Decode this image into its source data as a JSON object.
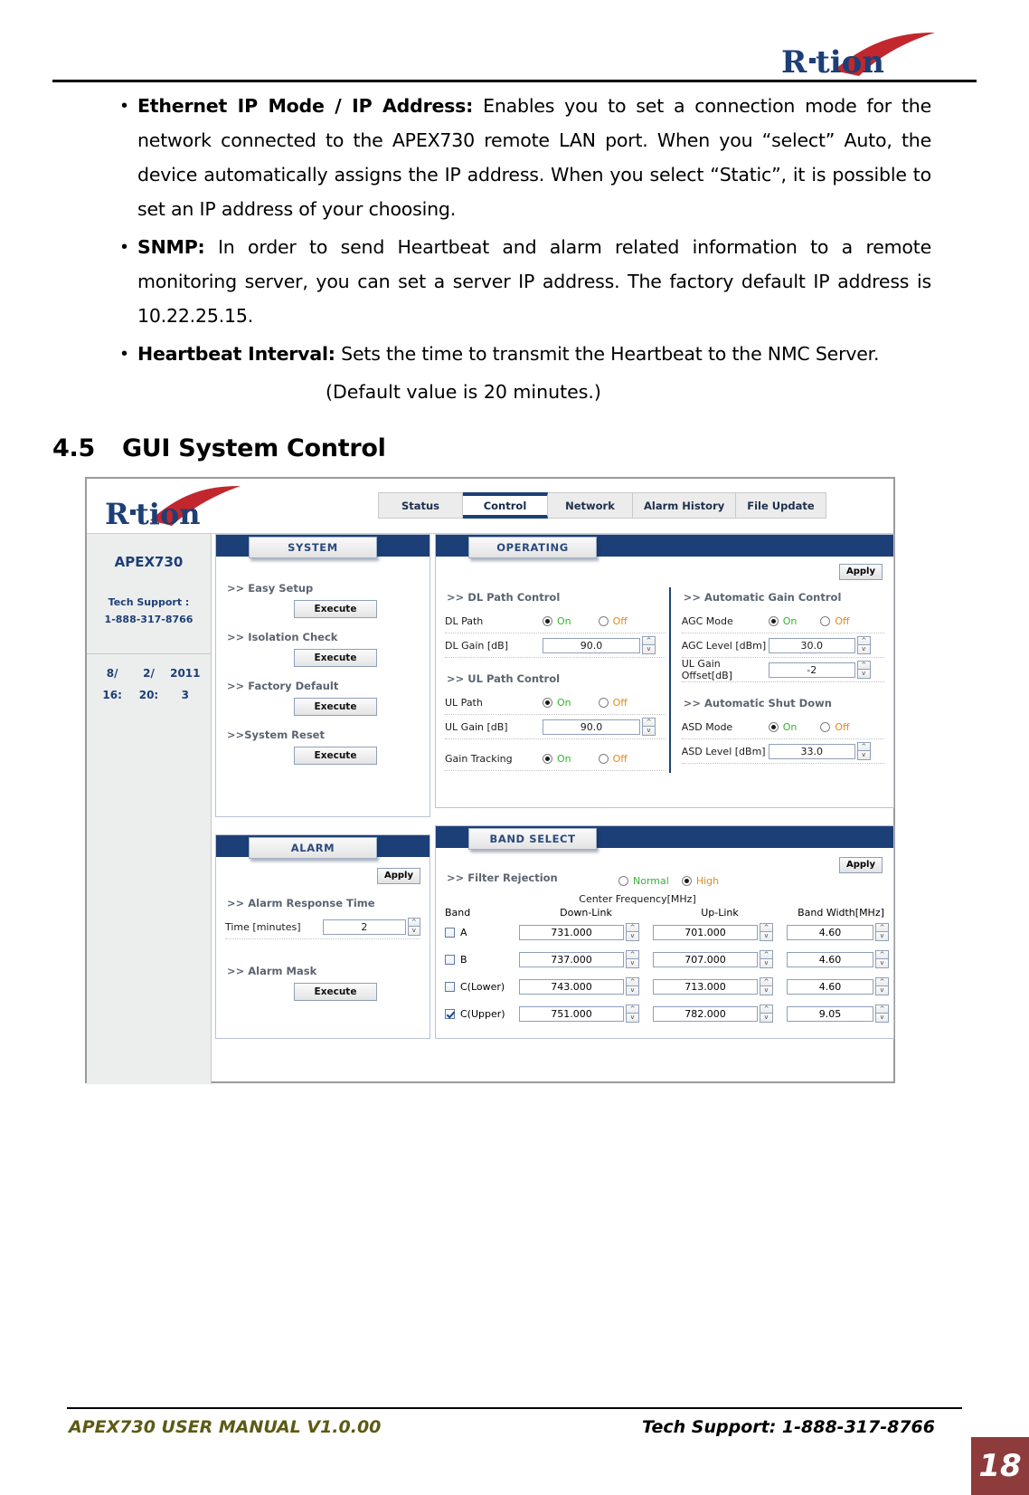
{
  "header": {
    "brand": "R-tion"
  },
  "content": {
    "bullets": [
      {
        "marker": "•",
        "term": "Ethernet IP Mode / IP Address:",
        "text": " Enables you to set a connection mode for the network connected to the APEX730 remote LAN port. When you “select” Auto, the device automatically assigns the IP address. When you select “Static”, it is possible to set an IP address of your choosing."
      },
      {
        "marker": "•",
        "term": "SNMP:",
        "text": " In order to send Heartbeat and alarm related information to a remote monitoring server, you can set a server IP address. The factory default IP address is 10.22.25.15."
      },
      {
        "marker": "•",
        "term": "Heartbeat Interval:",
        "text": " Sets the time to transmit the Heartbeat to the NMC Server."
      }
    ],
    "default_note": "(Default value is 20 minutes.)",
    "section": {
      "number": "4.5",
      "title": "GUI System Control"
    }
  },
  "gui": {
    "tabs": [
      {
        "label": "Status",
        "active": false
      },
      {
        "label": "Control",
        "active": true
      },
      {
        "label": "Network",
        "active": false
      },
      {
        "label": "Alarm History",
        "active": false
      },
      {
        "label": "File Update",
        "active": false
      }
    ],
    "sidebar": {
      "model": "APEX730",
      "support_label": "Tech Support :",
      "support_phone": "1-888-317-8766",
      "clock": [
        "8/",
        "2/",
        "2011",
        "16:",
        "20:",
        "3"
      ]
    },
    "system_panel": {
      "title": "SYSTEM",
      "items": [
        {
          "label": ">> Easy Setup",
          "button": "Execute"
        },
        {
          "label": ">> Isolation Check",
          "button": "Execute"
        },
        {
          "label": ">> Factory Default",
          "button": "Execute"
        },
        {
          "label": ">>System Reset",
          "button": "Execute"
        }
      ]
    },
    "alarm_panel": {
      "title": "ALARM",
      "apply_label": "Apply",
      "response_time_title": ">> Alarm Response Time",
      "time_label": "Time [minutes]",
      "time_value": "2",
      "alarm_mask_title": ">> Alarm Mask",
      "alarm_mask_button": "Execute"
    },
    "operating_panel": {
      "title": "OPERATING",
      "apply_label": "Apply",
      "dl_section": ">> DL Path Control",
      "dl_path_label": "DL Path",
      "dl_path_on": "On",
      "dl_path_off": "Off",
      "dl_path_value": "On",
      "dl_gain_label": "DL Gain [dB]",
      "dl_gain_value": "90.0",
      "ul_section": ">> UL Path Control",
      "ul_path_label": "UL Path",
      "ul_path_on": "On",
      "ul_path_off": "Off",
      "ul_path_value": "On",
      "ul_gain_label": "UL Gain [dB]",
      "ul_gain_value": "90.0",
      "gain_tracking_label": "Gain Tracking",
      "gain_tracking_on": "On",
      "gain_tracking_off": "Off",
      "gain_tracking_value": "On",
      "agc_section": ">> Automatic Gain Control",
      "agc_mode_label": "AGC Mode",
      "agc_mode_on": "On",
      "agc_mode_off": "Off",
      "agc_mode_value": "On",
      "agc_level_label": "AGC Level [dBm]",
      "agc_level_value": "30.0",
      "ul_offset_label": "UL Gain Offset[dB]",
      "ul_offset_value": "-2",
      "asd_section": ">> Automatic Shut Down",
      "asd_mode_label": "ASD Mode",
      "asd_mode_on": "On",
      "asd_mode_off": "Off",
      "asd_mode_value": "On",
      "asd_level_label": "ASD Level [dBm]",
      "asd_level_value": "33.0"
    },
    "band_panel": {
      "title": "BAND SELECT",
      "apply_label": "Apply",
      "filter_rejection_label": ">> Filter Rejection",
      "filter_normal": "Normal",
      "filter_high": "High",
      "filter_value": "High",
      "center_freq_caption": "Center Frequency[MHz]",
      "columns": [
        "Band",
        "Down-Link",
        "Up-Link",
        "Band Width[MHz]"
      ],
      "rows": [
        {
          "band": "A",
          "checked": false,
          "downlink": "731.000",
          "uplink": "701.000",
          "bandwidth": "4.60"
        },
        {
          "band": "B",
          "checked": false,
          "downlink": "737.000",
          "uplink": "707.000",
          "bandwidth": "4.60"
        },
        {
          "band": "C(Lower)",
          "checked": false,
          "downlink": "743.000",
          "uplink": "713.000",
          "bandwidth": "4.60"
        },
        {
          "band": "C(Upper)",
          "checked": true,
          "downlink": "751.000",
          "uplink": "782.000",
          "bandwidth": "9.05"
        }
      ]
    },
    "spinner": {
      "up": "^",
      "down": "v"
    }
  },
  "footer": {
    "left": "APEX730 USER MANUAL V1.0.00",
    "right": "Tech Support: 1-888-317-8766",
    "page": "18"
  }
}
